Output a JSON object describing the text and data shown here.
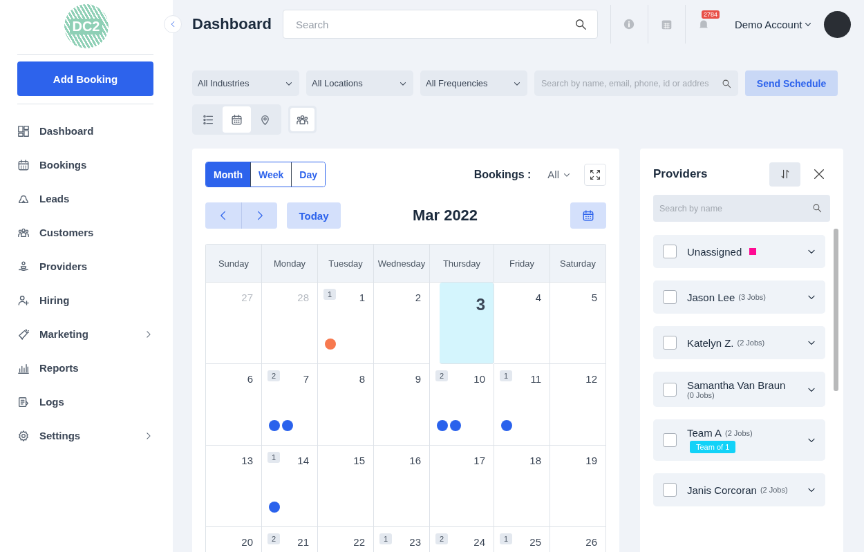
{
  "sidebar": {
    "logo_text": "DC2",
    "add_button": "Add Booking",
    "items": [
      {
        "label": "Dashboard",
        "selected": false,
        "has_submenu": false
      },
      {
        "label": "Bookings",
        "selected": false,
        "has_submenu": false
      },
      {
        "label": "Leads",
        "selected": false,
        "has_submenu": false
      },
      {
        "label": "Customers",
        "selected": false,
        "has_submenu": false
      },
      {
        "label": "Providers",
        "selected": false,
        "has_submenu": false
      },
      {
        "label": "Hiring",
        "selected": false,
        "has_submenu": false
      },
      {
        "label": "Marketing",
        "selected": false,
        "has_submenu": true
      },
      {
        "label": "Reports",
        "selected": false,
        "has_submenu": false
      },
      {
        "label": "Logs",
        "selected": false,
        "has_submenu": false
      },
      {
        "label": "Settings",
        "selected": false,
        "has_submenu": true
      }
    ]
  },
  "header": {
    "title": "Dashboard",
    "search": {
      "placeholder": "Search"
    },
    "notification_count": "2784",
    "account": "Demo Account"
  },
  "filters": {
    "dropdowns": [
      "All Industries",
      "All Locations",
      "All Frequencies"
    ],
    "search": {
      "placeholder": "Search by name, email, phone, id or addres"
    },
    "send_button": "Send Schedule",
    "views": [
      {
        "kind": "list",
        "selected": false
      },
      {
        "kind": "calendar",
        "selected": true
      },
      {
        "kind": "map",
        "selected": false
      }
    ]
  },
  "calendar": {
    "view_tabs": [
      {
        "label": "Month",
        "selected": true
      },
      {
        "label": "Week",
        "selected": false
      },
      {
        "label": "Day",
        "selected": false
      }
    ],
    "bookings_label": "Bookings :",
    "bookings_filter": "All",
    "today_button": "Today",
    "month": "Mar 2022",
    "weekdays": [
      "Sunday",
      "Monday",
      "Tuesday",
      "Wednesday",
      "Thursday",
      "Friday",
      "Saturday"
    ],
    "weeks": [
      [
        {
          "day": "27",
          "muted": true,
          "today": false
        },
        {
          "day": "28",
          "muted": true,
          "today": false
        },
        {
          "day": "1",
          "muted": false,
          "today": false,
          "badge": "1",
          "dots": [
            {
              "color": "#f7794f"
            }
          ]
        },
        {
          "day": "2",
          "muted": false,
          "today": false
        },
        {
          "day": "3",
          "muted": false,
          "today": true
        },
        {
          "day": "4",
          "muted": false,
          "today": false
        },
        {
          "day": "5",
          "muted": false,
          "today": false
        }
      ],
      [
        {
          "day": "6",
          "muted": false,
          "today": false
        },
        {
          "day": "7",
          "muted": false,
          "today": false,
          "badge": "2",
          "dots": [
            {
              "color": "#2a62ec"
            },
            {
              "color": "#2a62ec"
            }
          ]
        },
        {
          "day": "8",
          "muted": false,
          "today": false
        },
        {
          "day": "9",
          "muted": false,
          "today": false
        },
        {
          "day": "10",
          "muted": false,
          "today": false,
          "badge": "2",
          "dots": [
            {
              "color": "#2a62ec"
            },
            {
              "color": "#2a62ec"
            }
          ]
        },
        {
          "day": "11",
          "muted": false,
          "today": false,
          "badge": "1",
          "dots": [
            {
              "color": "#2a62ec"
            }
          ]
        },
        {
          "day": "12",
          "muted": false,
          "today": false
        }
      ],
      [
        {
          "day": "13",
          "muted": false,
          "today": false
        },
        {
          "day": "14",
          "muted": false,
          "today": false,
          "badge": "1",
          "dots": [
            {
              "color": "#2a62ec"
            }
          ]
        },
        {
          "day": "15",
          "muted": false,
          "today": false
        },
        {
          "day": "16",
          "muted": false,
          "today": false
        },
        {
          "day": "17",
          "muted": false,
          "today": false
        },
        {
          "day": "18",
          "muted": false,
          "today": false
        },
        {
          "day": "19",
          "muted": false,
          "today": false
        }
      ],
      [
        {
          "day": "20",
          "muted": false,
          "today": false
        },
        {
          "day": "21",
          "muted": false,
          "today": false,
          "badge": "2"
        },
        {
          "day": "22",
          "muted": false,
          "today": false
        },
        {
          "day": "23",
          "muted": false,
          "today": false,
          "badge": "1"
        },
        {
          "day": "24",
          "muted": false,
          "today": false,
          "badge": "2"
        },
        {
          "day": "25",
          "muted": false,
          "today": false,
          "badge": "1"
        },
        {
          "day": "26",
          "muted": false,
          "today": false
        }
      ]
    ]
  },
  "providers": {
    "title": "Providers",
    "search": {
      "placeholder": "Search by name"
    },
    "items": [
      {
        "name": "Unassigned",
        "checked": false,
        "color": "#ff0a93"
      },
      {
        "name": "Jason Lee",
        "jobs": "(3 Jobs)",
        "checked": false
      },
      {
        "name": "Katelyn Z.",
        "jobs": "(2 Jobs)",
        "checked": false
      },
      {
        "name": "Samantha Van Braun",
        "jobs": "(0 Jobs)",
        "checked": false
      },
      {
        "name": "Team A",
        "jobs": "(2 Jobs)",
        "checked": false,
        "tag": "Team of 1"
      },
      {
        "name": "Janis Corcoran",
        "jobs": "(2 Jobs)",
        "checked": false
      }
    ]
  }
}
